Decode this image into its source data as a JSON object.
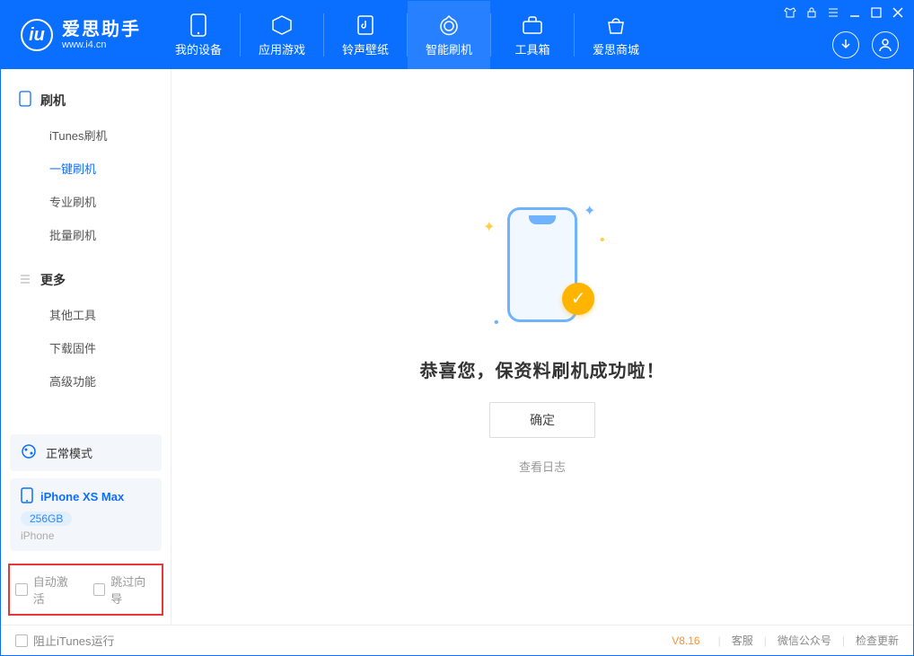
{
  "app": {
    "title": "爱思助手",
    "subtitle": "www.i4.cn"
  },
  "topnav": {
    "items": [
      {
        "label": "我的设备",
        "icon": "device-icon"
      },
      {
        "label": "应用游戏",
        "icon": "apps-icon"
      },
      {
        "label": "铃声壁纸",
        "icon": "ringtone-icon"
      },
      {
        "label": "智能刷机",
        "icon": "flash-icon",
        "active": true
      },
      {
        "label": "工具箱",
        "icon": "toolbox-icon"
      },
      {
        "label": "爱思商城",
        "icon": "store-icon"
      }
    ]
  },
  "sidebar": {
    "group1": {
      "label": "刷机"
    },
    "items1": [
      {
        "label": "iTunes刷机"
      },
      {
        "label": "一键刷机",
        "active": true
      },
      {
        "label": "专业刷机"
      },
      {
        "label": "批量刷机"
      }
    ],
    "group2": {
      "label": "更多"
    },
    "items2": [
      {
        "label": "其他工具"
      },
      {
        "label": "下载固件"
      },
      {
        "label": "高级功能"
      }
    ],
    "mode": {
      "label": "正常模式"
    },
    "device": {
      "name": "iPhone XS Max",
      "capacity": "256GB",
      "type": "iPhone"
    },
    "options": {
      "auto_activate": "自动激活",
      "skip_guide": "跳过向导"
    }
  },
  "main": {
    "success_title": "恭喜您，保资料刷机成功啦！",
    "ok_button": "确定",
    "view_log": "查看日志"
  },
  "footer": {
    "block_itunes": "阻止iTunes运行",
    "version": "V8.16",
    "links": {
      "service": "客服",
      "wechat": "微信公众号",
      "update": "检查更新"
    }
  }
}
